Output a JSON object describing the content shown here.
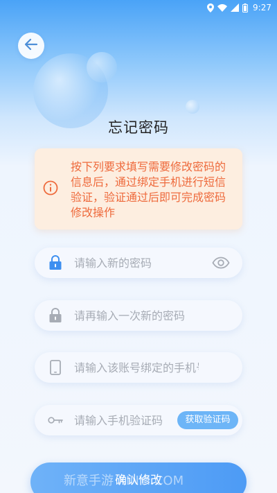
{
  "status_bar": {
    "time": "9:27"
  },
  "header": {
    "title": "忘记密码"
  },
  "notice": {
    "text": "按下列要求填写需要修改密码的信息后，通过绑定手机进行短信验证，验证通过后即可完成密码修改操作"
  },
  "form": {
    "new_password_placeholder": "请输入新的密码",
    "confirm_password_placeholder": "请再输入一次新的密码",
    "phone_placeholder": "请输入该账号绑定的手机号",
    "code_placeholder": "请输入手机验证码",
    "get_code_label": "获取验证码"
  },
  "submit": {
    "label": "确认修改"
  },
  "watermark": {
    "text": "新意手游 XINYI.COM"
  },
  "icons": {
    "back": "arrow-left-icon",
    "info": "info-circle-icon",
    "lock": "lock-icon",
    "eye": "eye-icon",
    "phone": "smartphone-icon",
    "key": "key-icon"
  },
  "colors": {
    "accent": "#4d9bf5",
    "notice_text": "#ee6a3c",
    "notice_bg": "#fdeee0",
    "lock_active": "#3d8ff0",
    "icon_muted": "#a7acb5"
  }
}
